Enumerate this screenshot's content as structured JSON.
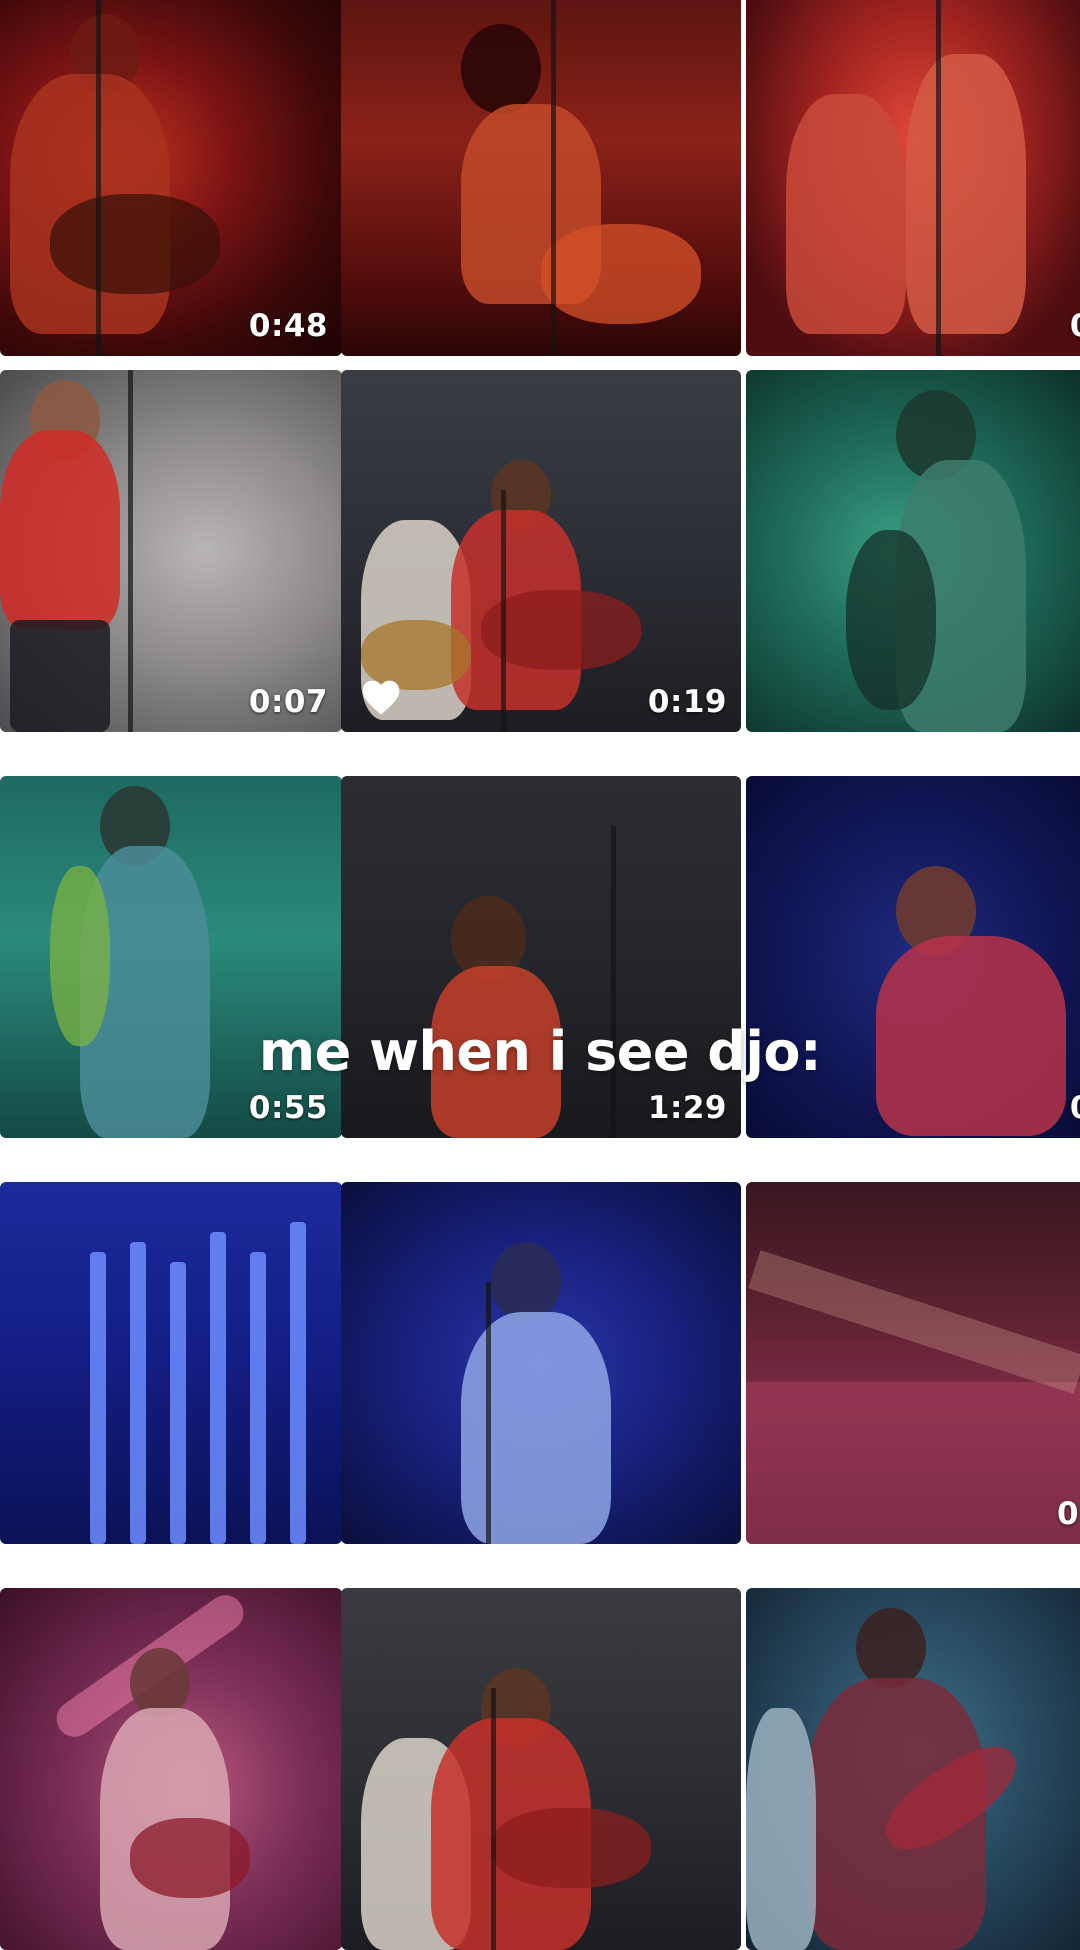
{
  "caption": "me when i see djo:",
  "tiles": [
    {
      "duration": "0:48",
      "theme": "red"
    },
    {
      "duration": "",
      "theme": "red"
    },
    {
      "duration": "0",
      "theme": "red"
    },
    {
      "duration": "0:07",
      "theme": "grey"
    },
    {
      "duration": "0:19",
      "theme": "grey",
      "liked": true
    },
    {
      "duration": "",
      "theme": "teal"
    },
    {
      "duration": "0:55",
      "theme": "teal"
    },
    {
      "duration": "1:29",
      "theme": "dark"
    },
    {
      "duration": "0",
      "theme": "blue"
    },
    {
      "duration": "",
      "theme": "blue"
    },
    {
      "duration": "",
      "theme": "blue"
    },
    {
      "duration": "0:",
      "theme": "crowd"
    },
    {
      "duration": "",
      "theme": "pink"
    },
    {
      "duration": "",
      "theme": "grey"
    },
    {
      "duration": "",
      "theme": "teal"
    }
  ],
  "icons": {
    "heart": "heart-icon"
  },
  "colors": {
    "background": "#ffffff",
    "text": "#ffffff"
  }
}
